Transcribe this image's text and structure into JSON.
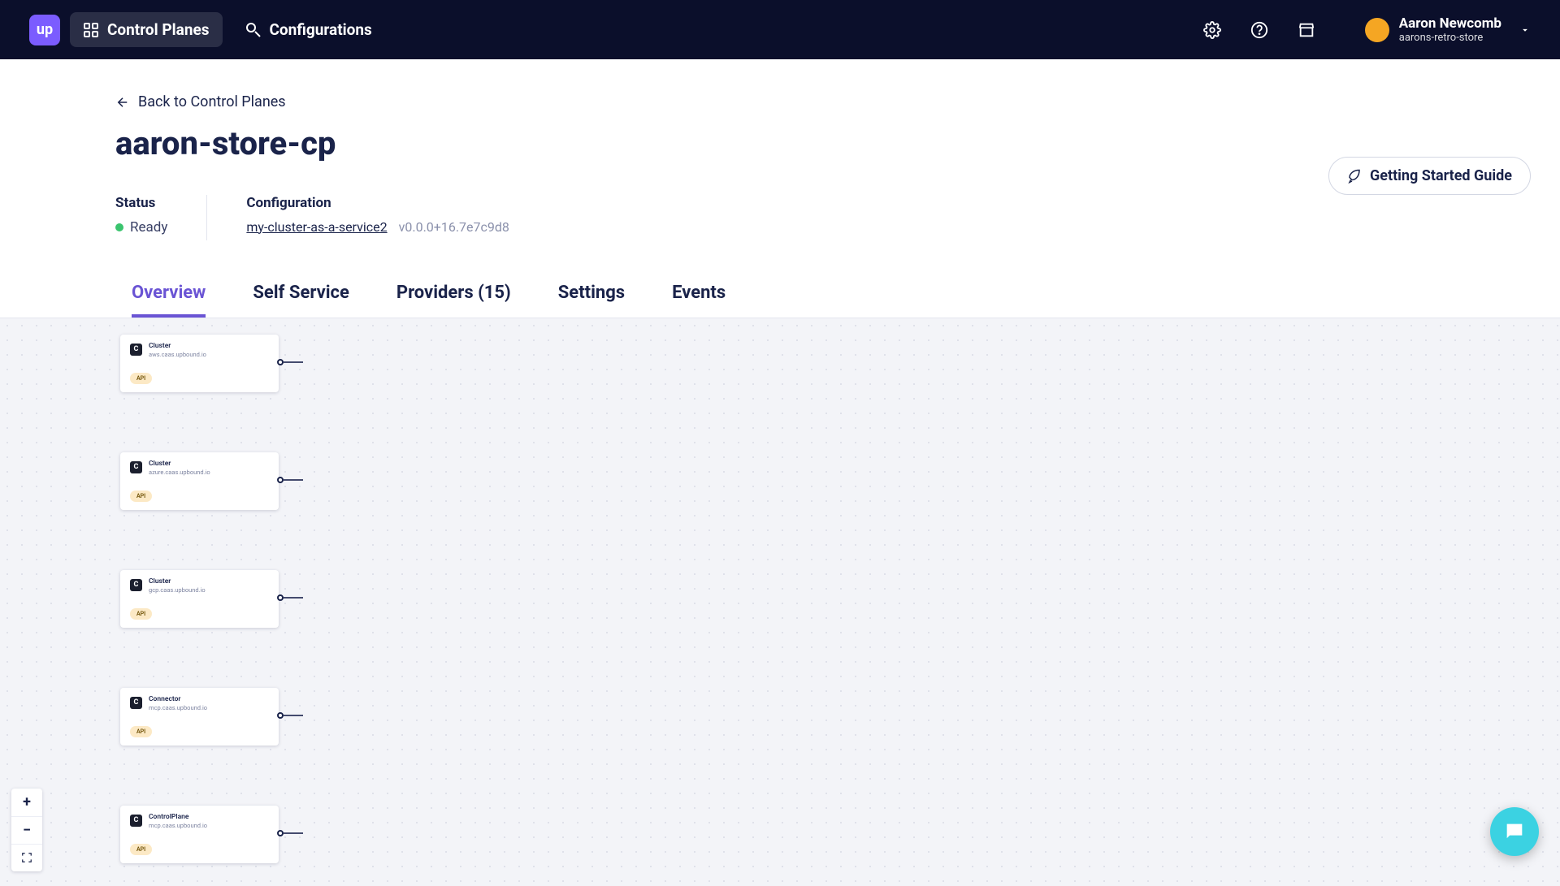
{
  "header": {
    "nav": {
      "control_planes": "Control Planes",
      "configurations": "Configurations"
    },
    "user": {
      "name": "Aaron Newcomb",
      "org": "aarons-retro-store"
    }
  },
  "back_link": "Back to Control Planes",
  "page_title": "aaron-store-cp",
  "getting_started": "Getting Started Guide",
  "status": {
    "label": "Status",
    "value": "Ready"
  },
  "configuration": {
    "label": "Configuration",
    "link": "my-cluster-as-a-service2",
    "version": "v0.0.0+16.7e7c9d8"
  },
  "tabs": {
    "overview": "Overview",
    "self_service": "Self Service",
    "providers": "Providers (15)",
    "settings": "Settings",
    "events": "Events"
  },
  "nodes": [
    {
      "title": "Cluster",
      "sub": "aws.caas.upbound.io",
      "badge": "API"
    },
    {
      "title": "Cluster",
      "sub": "azure.caas.upbound.io",
      "badge": "API"
    },
    {
      "title": "Cluster",
      "sub": "gcp.caas.upbound.io",
      "badge": "API"
    },
    {
      "title": "Connector",
      "sub": "mcp.caas.upbound.io",
      "badge": "API"
    },
    {
      "title": "ControlPlane",
      "sub": "mcp.caas.upbound.io",
      "badge": "API"
    }
  ]
}
